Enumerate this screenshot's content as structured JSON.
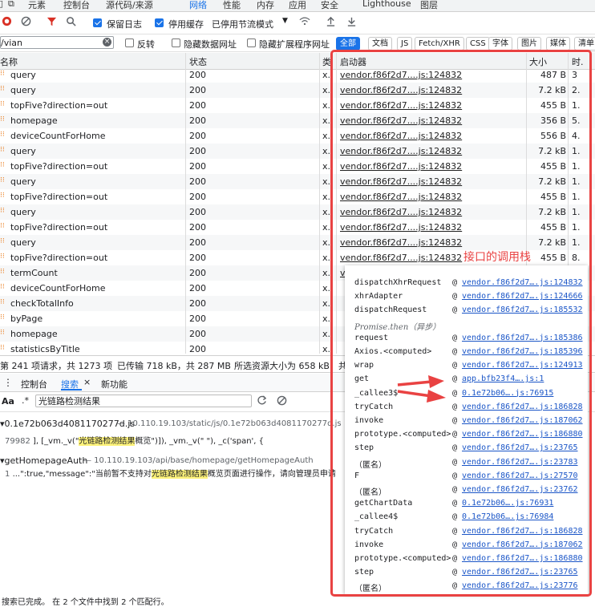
{
  "top_tabs": [
    "元素",
    "控制台",
    "源代码/来源",
    "网络",
    "性能",
    "内存",
    "应用",
    "安全",
    "Lighthouse",
    "图层"
  ],
  "toolbar": {
    "preserve_log": "保留日志",
    "disable_cache": "停用缓存",
    "throttle": "已停用节流模式"
  },
  "filter": {
    "value": "/vian",
    "invert": "反转",
    "hide_data_urls": "隐藏数据网址",
    "hide_ext_urls": "隐藏扩展程序网址",
    "chips": [
      "全部",
      "文档",
      "JS",
      "Fetch/XHR",
      "CSS",
      "字体",
      "图片",
      "媒体",
      "清单"
    ]
  },
  "columns": {
    "name": "名称",
    "status": "状态",
    "type": "类",
    "initiator": "启动器",
    "size": "大小",
    "time": "时."
  },
  "rows": [
    {
      "name": "query",
      "status": "200",
      "type": "x.",
      "initiator": "vendor.f86f2d7....js:124832",
      "size": "487 B",
      "time": "3"
    },
    {
      "name": "query",
      "status": "200",
      "type": "x.",
      "initiator": "vendor.f86f2d7....js:124832",
      "size": "7.2 kB",
      "time": "2."
    },
    {
      "name": "topFive?direction=out",
      "status": "200",
      "type": "x.",
      "initiator": "vendor.f86f2d7....js:124832",
      "size": "455 B",
      "time": "1."
    },
    {
      "name": "homepage",
      "status": "200",
      "type": "x.",
      "initiator": "vendor.f86f2d7....js:124832",
      "size": "356 B",
      "time": "5."
    },
    {
      "name": "deviceCountForHome",
      "status": "200",
      "type": "x.",
      "initiator": "vendor.f86f2d7....js:124832",
      "size": "556 B",
      "time": "4."
    },
    {
      "name": "query",
      "status": "200",
      "type": "x.",
      "initiator": "vendor.f86f2d7....js:124832",
      "size": "7.2 kB",
      "time": "1."
    },
    {
      "name": "topFive?direction=out",
      "status": "200",
      "type": "x.",
      "initiator": "vendor.f86f2d7....js:124832",
      "size": "455 B",
      "time": "1."
    },
    {
      "name": "query",
      "status": "200",
      "type": "x.",
      "initiator": "vendor.f86f2d7....js:124832",
      "size": "7.2 kB",
      "time": "1."
    },
    {
      "name": "topFive?direction=out",
      "status": "200",
      "type": "x.",
      "initiator": "vendor.f86f2d7....js:124832",
      "size": "455 B",
      "time": "1."
    },
    {
      "name": "query",
      "status": "200",
      "type": "x.",
      "initiator": "vendor.f86f2d7....js:124832",
      "size": "7.2 kB",
      "time": "1."
    },
    {
      "name": "topFive?direction=out",
      "status": "200",
      "type": "x.",
      "initiator": "vendor.f86f2d7....js:124832",
      "size": "455 B",
      "time": "1."
    },
    {
      "name": "query",
      "status": "200",
      "type": "x.",
      "initiator": "vendor.f86f2d7....js:124832",
      "size": "7.2 kB",
      "time": "1."
    },
    {
      "name": "topFive?direction=out",
      "status": "200",
      "type": "x.",
      "initiator": "vendor.f86f2d7....js:124832",
      "size": "455 B",
      "time": "8."
    },
    {
      "name": "termCount",
      "status": "200",
      "type": "x.",
      "initiator": "vendor.f86f2d7....js:124832",
      "size": "424 B",
      "time": "2."
    },
    {
      "name": "deviceCountForHome",
      "status": "200",
      "type": "x.",
      "initiator": "",
      "size": "",
      "time": ""
    },
    {
      "name": "checkTotalInfo",
      "status": "200",
      "type": "x.",
      "initiator": "",
      "size": "",
      "time": ""
    },
    {
      "name": "byPage",
      "status": "200",
      "type": "x.",
      "initiator": "",
      "size": "",
      "time": ""
    },
    {
      "name": "homepage",
      "status": "200",
      "type": "x.",
      "initiator": "",
      "size": "",
      "time": ""
    },
    {
      "name": "statisticsByTitle",
      "status": "200",
      "type": "x.",
      "initiator": "",
      "size": "",
      "time": ""
    }
  ],
  "status_bar": {
    "requests": "第 241 项请求，共 1273 项",
    "transferred": "已传输 718 kB，共 287 MB",
    "resources": "所选资源大小为 658 kB，共 3"
  },
  "drawer_tabs": [
    "控制台",
    "搜索",
    "新功能"
  ],
  "search": {
    "query": "光链路检测结果",
    "aa": "Aa",
    "regex": ".*",
    "file1": "▾0.1e72b063d4081170277d.js",
    "file1_url": "— 10.110.19.103/static/js/0.1e72b063d4081170277d.js",
    "file1_line": "79982",
    "file1_pre": "], [_vm._v(\"",
    "file1_match": "光链路检测结果",
    "file1_post": "概览\")]), _vm._v(\" \"), _c('span', {",
    "file2": "▾getHomepageAuth",
    "file2_url": "— 10.110.19.103/api/base/homepage/getHomepageAuth",
    "file2_line": "1",
    "file2_pre": "...\":true,\"message\":\"当前暂不支持对",
    "file2_match": "光链路检测结果",
    "file2_post": "概览页面进行操作，请向管理员申请"
  },
  "bottom_status": "搜索已完成。   在 2 个文件中找到 2 个匹配行。",
  "annotation": "接口的调用栈",
  "callstack": [
    {
      "fn": "dispatchXhrRequest",
      "at": "@",
      "link": "vendor.f86f2d7….js:124832"
    },
    {
      "fn": "xhrAdapter",
      "at": "@",
      "link": "vendor.f86f2d7….js:124666"
    },
    {
      "fn": "dispatchRequest",
      "at": "@",
      "link": "vendor.f86f2d7….js:185532"
    },
    {
      "fn": "Promise.then（异步）",
      "at": "",
      "link": "",
      "italic": true
    },
    {
      "fn": "request",
      "at": "@",
      "link": "vendor.f86f2d7….js:185386"
    },
    {
      "fn": "Axios.<computed>",
      "at": "@",
      "link": "vendor.f86f2d7….js:185396"
    },
    {
      "fn": "wrap",
      "at": "@",
      "link": "vendor.f86f2d7….js:124913"
    },
    {
      "fn": "get",
      "at": "@",
      "link": "app.bfb23f4….js:1"
    },
    {
      "fn": "_callee3$",
      "at": "@",
      "link": "0.1e72b06….js:76915"
    },
    {
      "fn": "tryCatch",
      "at": "@",
      "link": "vendor.f86f2d7….js:186828"
    },
    {
      "fn": "invoke",
      "at": "@",
      "link": "vendor.f86f2d7….js:187062"
    },
    {
      "fn": "prototype.<computed>",
      "at": "@",
      "link": "vendor.f86f2d7….js:186880"
    },
    {
      "fn": "step",
      "at": "@",
      "link": "vendor.f86f2d7….js:23765"
    },
    {
      "fn": "（匿名）",
      "at": "@",
      "link": "vendor.f86f2d7….js:23783"
    },
    {
      "fn": "F",
      "at": "@",
      "link": "vendor.f86f2d7….js:27570"
    },
    {
      "fn": "（匿名）",
      "at": "@",
      "link": "vendor.f86f2d7….js:23762"
    },
    {
      "fn": "getChartData",
      "at": "@",
      "link": "0.1e72b06….js:76931"
    },
    {
      "fn": "_callee4$",
      "at": "@",
      "link": "0.1e72b06….js:76984"
    },
    {
      "fn": "tryCatch",
      "at": "@",
      "link": "vendor.f86f2d7….js:186828"
    },
    {
      "fn": "invoke",
      "at": "@",
      "link": "vendor.f86f2d7….js:187062"
    },
    {
      "fn": "prototype.<computed>",
      "at": "@",
      "link": "vendor.f86f2d7….js:186880"
    },
    {
      "fn": "step",
      "at": "@",
      "link": "vendor.f86f2d7….js:23765"
    },
    {
      "fn": "（匿名）",
      "at": "@",
      "link": "vendor.f86f2d7….js:23776"
    }
  ],
  "icons": {
    "record": "stop-record-icon",
    "clear": "clear-icon",
    "filter": "filter-icon",
    "search": "search-icon",
    "wifi": "network-conditions-icon",
    "upload": "import-har-icon",
    "download": "export-har-icon"
  },
  "colors": {
    "accent": "#1a73e8",
    "annotation": "#e94242",
    "highlight": "#fdf27a",
    "record": "#d93025"
  }
}
